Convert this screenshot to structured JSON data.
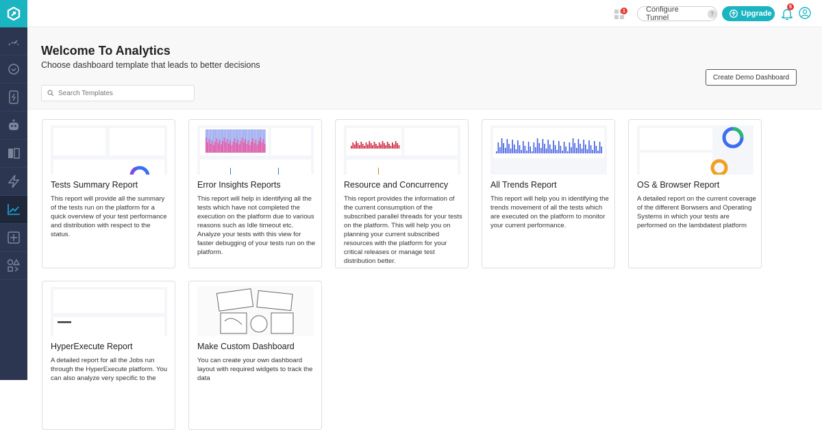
{
  "sidebar": {
    "items": [
      "speedometer-icon",
      "clock-icon",
      "mobile-icon",
      "robot-icon",
      "split-screen-icon",
      "lightning-icon",
      "analytics-icon",
      "plus-square-icon",
      "integrations-icon"
    ],
    "active": "analytics-icon",
    "accent": "#1bb4c1"
  },
  "header": {
    "apps_badge": "1",
    "configure_tunnel": "Configure Tunnel",
    "help": "?",
    "upgrade": "Upgrade",
    "notifications_badge": "5"
  },
  "page": {
    "title": "Welcome To Analytics",
    "subtitle": "Choose dashboard template that leads to better decisions",
    "search_placeholder": "Search Templates",
    "create_demo": "Create Demo Dashboard"
  },
  "cards": [
    {
      "title": "Tests Summary Report",
      "desc": "This report will provide all the summary of the tests run on the platform for a quick overview of your test performance and distribution with respect to the status."
    },
    {
      "title": "Error Insights Reports",
      "desc": "This report will help in identifying all the tests which have not completed the execution on the platform due to various reasons such as Idle timeout etc. Analyze your tests with this view for faster debugging of your tests run on the platform."
    },
    {
      "title": "Resource and Concurrency",
      "desc": "This report provides the information of the current consumption of the subscribed parallel threads for your tests on the platform. This will help you on planning your current subscribed resources with the platform for your critical releases or manage test distribution better."
    },
    {
      "title": "All Trends Report",
      "desc": "This report will help you in identifying the trends movement of all the tests which are executed on the platform to monitor your current performance."
    },
    {
      "title": "OS & Browser Report",
      "desc": "A detailed report on the current coverage of the different Borwsers and Operating Systems in which your tests are performed on the lambdatest platform"
    },
    {
      "title": "HyperExecute Report",
      "desc": "A detailed report for all the Jobs run through the HyperExecute platform. You can also analyze very specific to the"
    },
    {
      "title": "Make Custom Dashboard",
      "desc": "You can create your own dashboard layout with required widgets to track the data"
    }
  ]
}
